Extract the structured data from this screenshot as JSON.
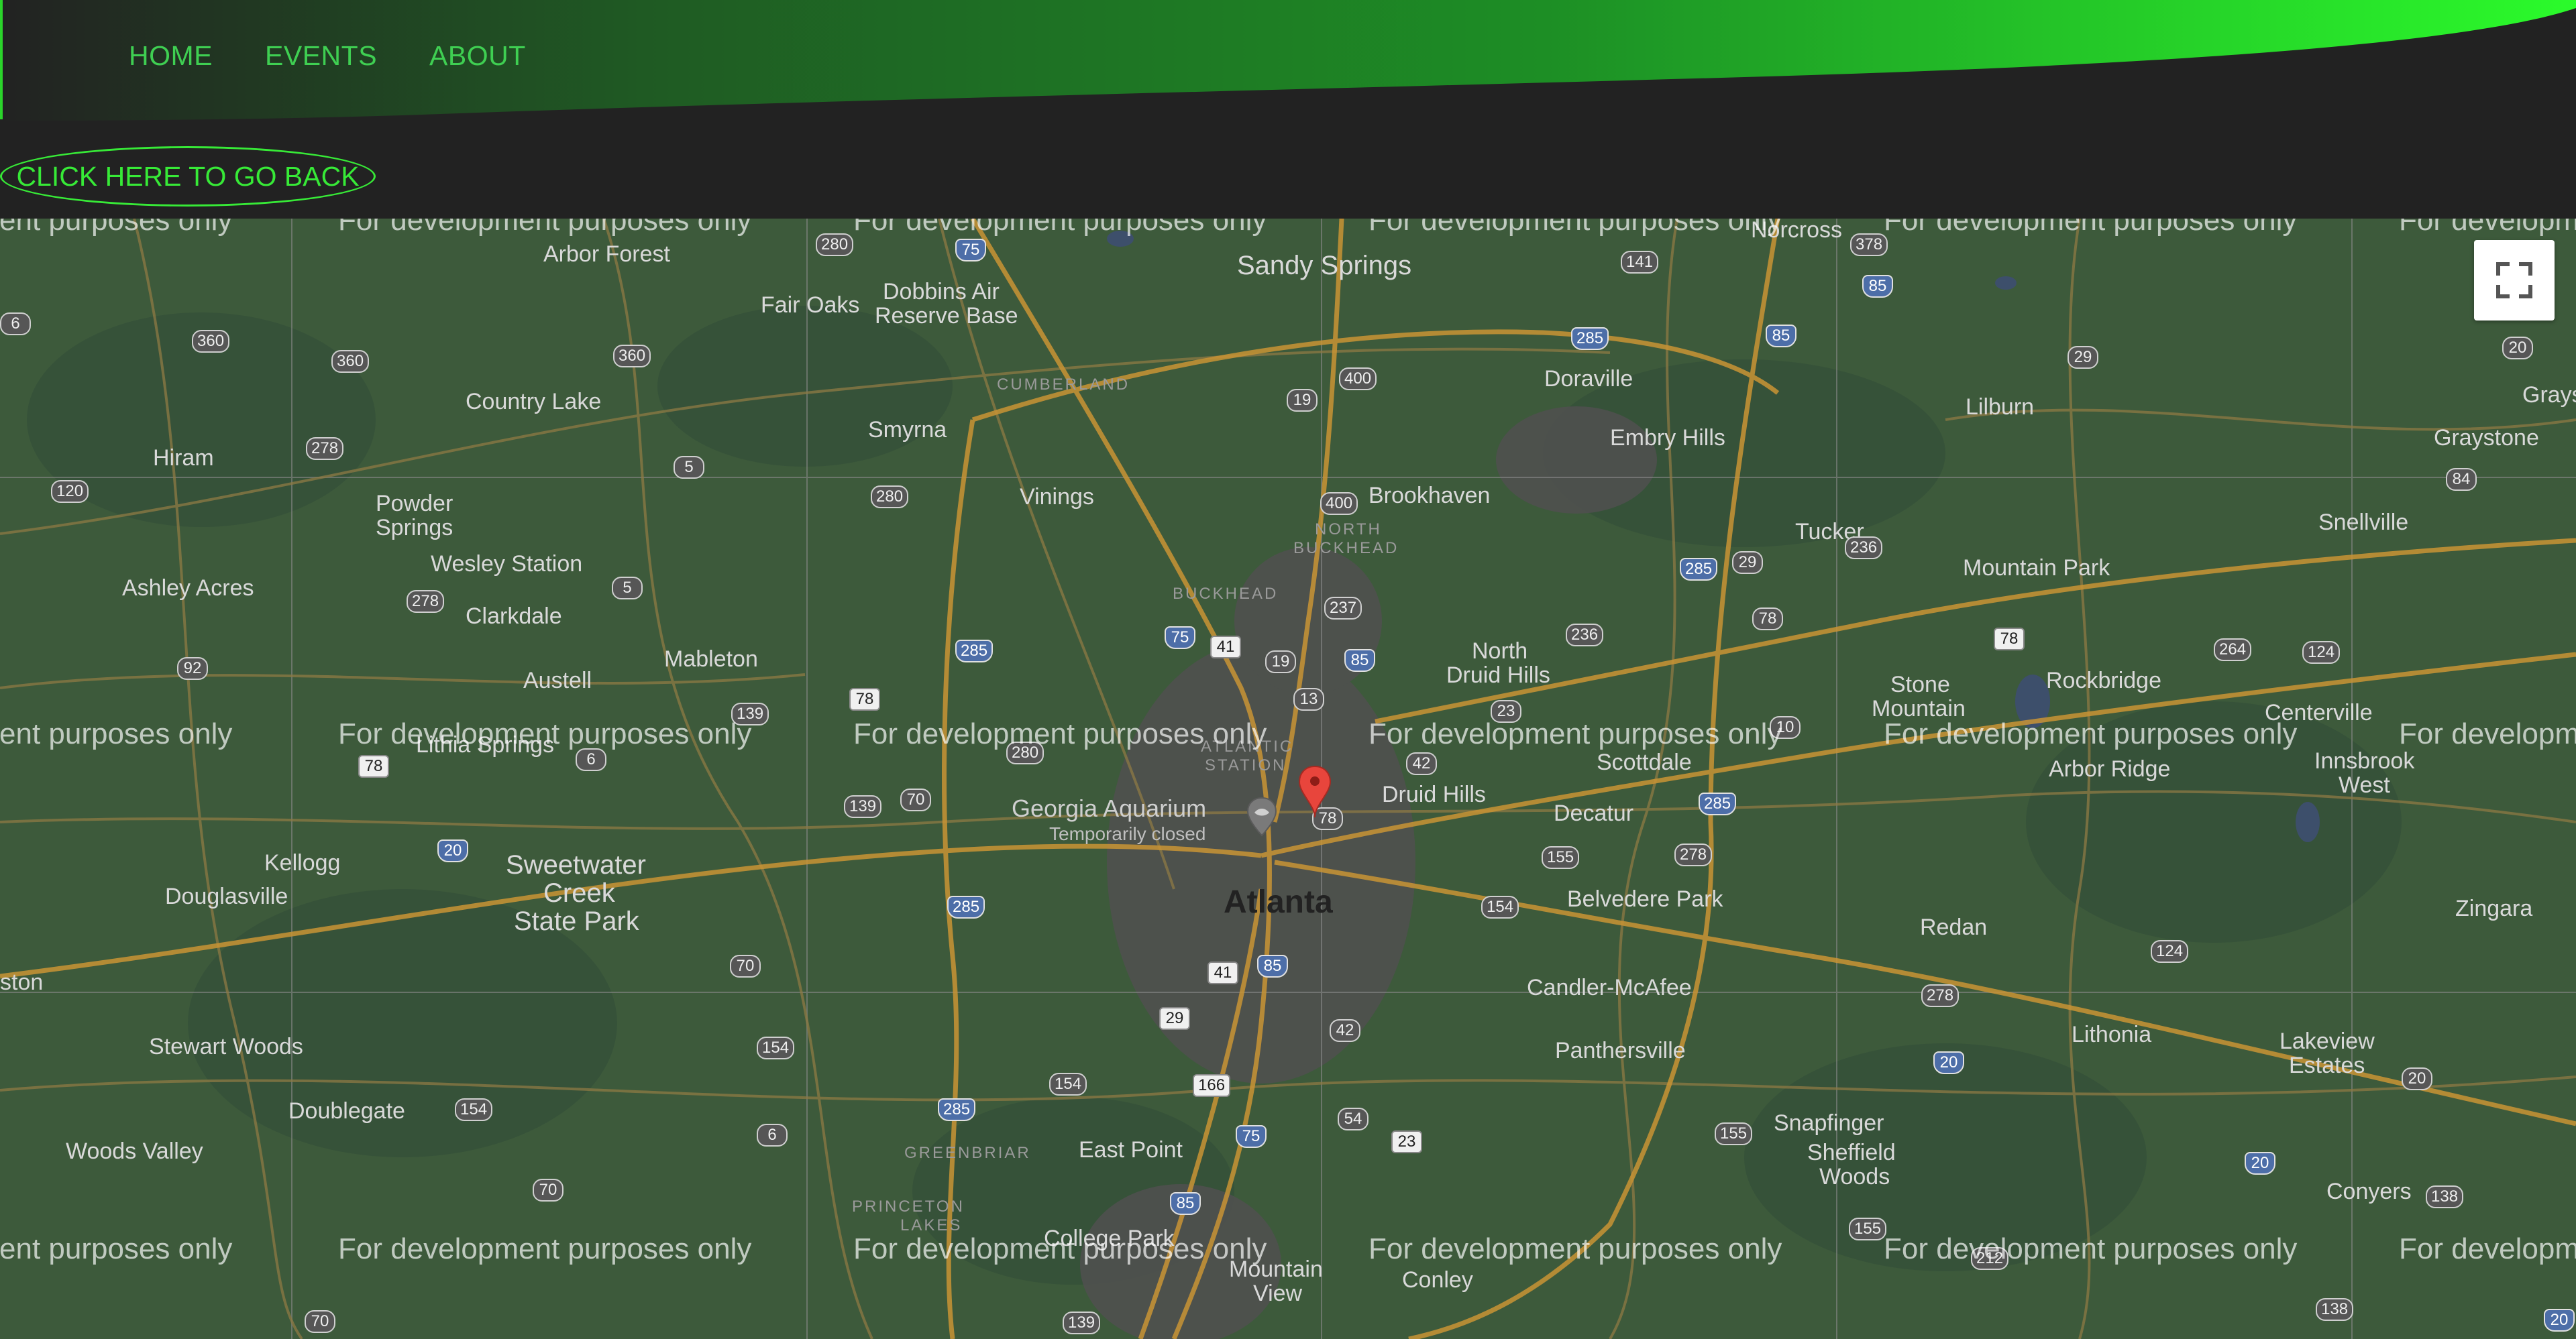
{
  "nav": {
    "home": "HOME",
    "events": "EVENTS",
    "about": "ABOUT"
  },
  "back_button": "CLICK HERE TO GO BACK",
  "colors": {
    "header_bg": "#222222",
    "accent_green": "#2bfb2b",
    "link_green": "#3fcf52",
    "map_land": "#3c5b3a",
    "marker_red": "#e8453c"
  },
  "map": {
    "watermark": "For development purposes only",
    "fullscreen_icon": "fullscreen-icon",
    "marker_icon": "map-pin-icon",
    "places": {
      "arbor_forest": "Arbor Forest",
      "sandy_springs": "Sandy Springs",
      "fair_oaks": "Fair Oaks",
      "dobbins": "Dobbins Air",
      "dobbins2": "Reserve Base",
      "cumberland": "CUMBERLAND",
      "doraville": "Doraville",
      "lilburn": "Lilburn",
      "grayson": "Graysc",
      "graystone": "Graystone",
      "country_lake": "Country Lake",
      "smyrna": "Smyrna",
      "embry_hills": "Embry Hills",
      "hiram": "Hiram",
      "powder_springs": "Powder",
      "powder_springs2": "Springs",
      "vinings": "Vinings",
      "brookhaven": "Brookhaven",
      "north_buckhead": "NORTH",
      "north_buckhead2": "BUCKHEAD",
      "tucker": "Tucker",
      "snellville": "Snellville",
      "ashley_acres": "Ashley Acres",
      "wesley_station": "Wesley Station",
      "clarkdale": "Clarkdale",
      "mountain_park": "Mountain Park",
      "buckhead": "BUCKHEAD",
      "north_druid_hills": "North",
      "north_druid_hills2": "Druid Hills",
      "mableton": "Mableton",
      "austell": "Austell",
      "stone_mountain": "Stone",
      "stone_mountain2": "Mountain",
      "rockbridge": "Rockbridge",
      "centerville": "Centerville",
      "lithia_springs": "Lithia Springs",
      "atlantic_station": "ATLANTIC",
      "atlantic_station2": "STATION",
      "scottdale": "Scottdale",
      "arbor_ridge": "Arbor Ridge",
      "innsbrook": "Innsbrook",
      "innsbrook2": "West",
      "georgia_aquarium": "Georgia Aquarium",
      "temporarily_closed": "Temporarily closed",
      "druid_hills": "Druid Hills",
      "decatur": "Decatur",
      "kellogg": "Kellogg",
      "sweetwater": "Sweetwater",
      "sweetwater2": "Creek",
      "sweetwater3": "State Park",
      "douglasville": "Douglasville",
      "atlanta": "Atlanta",
      "belvedere_park": "Belvedere Park",
      "zingara": "Zingara",
      "redan": "Redan",
      "ston": "ston",
      "candler_mcafee": "Candler-McAfee",
      "stewart_woods": "Stewart Woods",
      "lithonia": "Lithonia",
      "panthersville": "Panthersville",
      "lakeview_estates": "Lakeview",
      "lakeview_estates2": "Estates",
      "doublegate": "Doublegate",
      "snapfinger": "Snapfinger",
      "woods_valley": "Woods Valley",
      "east_point": "East Point",
      "greenbriar": "GREENBRIAR",
      "sheffield_woods": "Sheffield",
      "sheffield_woods2": "Woods",
      "conyers": "Conyers",
      "princeton_lakes": "PRINCETON",
      "princeton_lakes2": "LAKES",
      "college_park": "College Park",
      "mountain_view": "Mountain",
      "mountain_view2": "View",
      "conley": "Conley",
      "norcross": "Norcross"
    }
  }
}
